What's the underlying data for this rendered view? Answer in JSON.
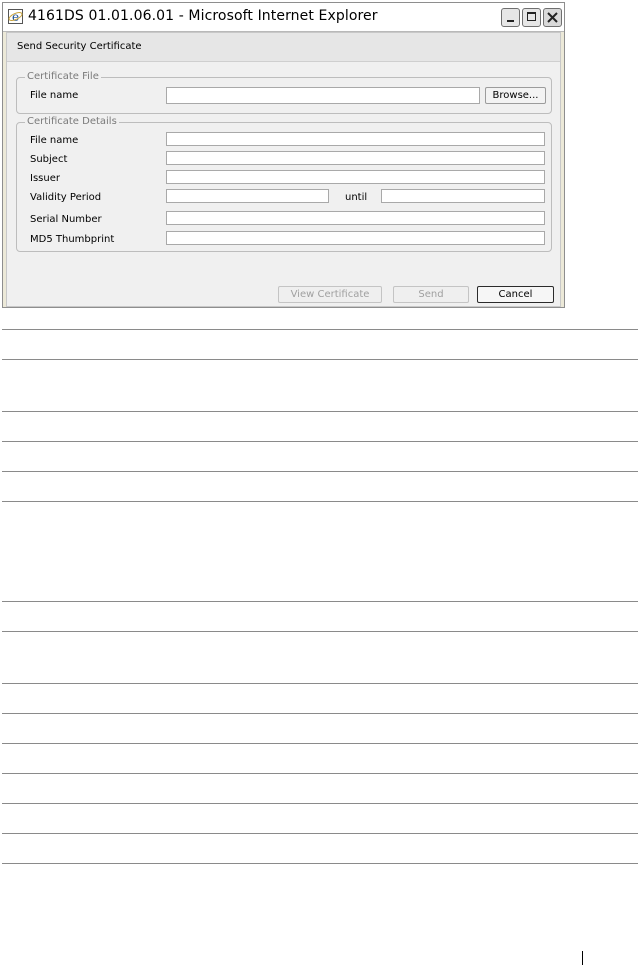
{
  "window": {
    "title": "4161DS 01.01.06.01 - Microsoft Internet Explorer"
  },
  "dialog": {
    "header": "Send Security Certificate",
    "certificate_file": {
      "legend": "Certificate File",
      "file_name_label": "File name",
      "file_name_value": "",
      "browse_label": "Browse..."
    },
    "certificate_details": {
      "legend": "Certificate Details",
      "file_name_label": "File name",
      "subject_label": "Subject",
      "issuer_label": "Issuer",
      "validity_label": "Validity Period",
      "until_label": "until",
      "serial_label": "Serial Number",
      "md5_label": "MD5 Thumbprint",
      "file_name_value": "",
      "subject_value": "",
      "issuer_value": "",
      "validity_from_value": "",
      "validity_until_value": "",
      "serial_value": "",
      "md5_value": ""
    },
    "buttons": {
      "view_certificate": "View Certificate",
      "send": "Send",
      "cancel": "Cancel"
    }
  },
  "icons": [
    "ie-logo-icon",
    "minimize-icon",
    "maximize-icon",
    "close-icon"
  ],
  "colors": {
    "titlebar_close": "#d9d9d9",
    "dialog_bg": "#f0f0f0"
  }
}
